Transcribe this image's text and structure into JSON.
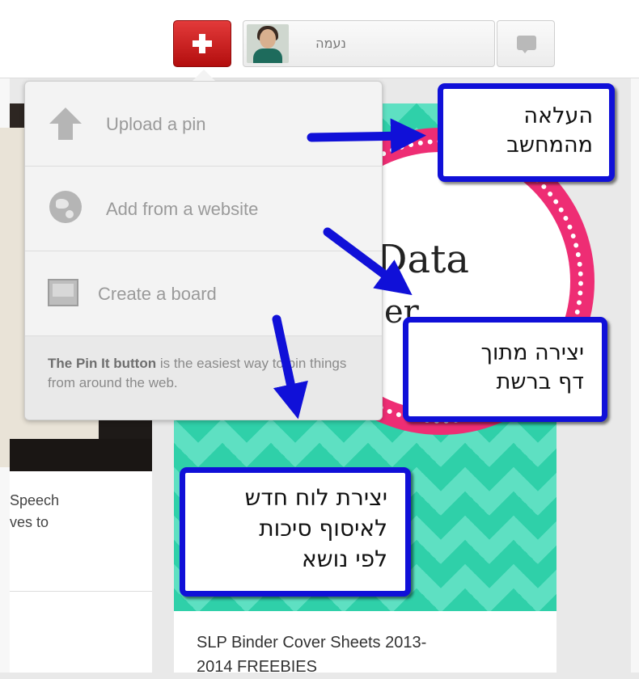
{
  "header": {
    "add_button_label": "+",
    "user_name": "נעמה"
  },
  "menu": {
    "items": [
      {
        "label": "Upload a pin",
        "icon": "upload-arrow-icon"
      },
      {
        "label": "Add from a website",
        "icon": "globe-icon"
      },
      {
        "label": "Create a board",
        "icon": "board-icon"
      }
    ],
    "footer": {
      "bold": "The Pin It button",
      "rest": " is the easiest way to pin things from around the web."
    }
  },
  "feed": {
    "left_card": {
      "description": "Speech\nves to"
    },
    "right_card": {
      "image_title": "Data",
      "image_subtitle": "er",
      "caption": "SLP Binder Cover Sheets 2013-\n2014 FREEBIES"
    }
  },
  "callouts": {
    "upload": [
      "העלאה",
      "מהמחשב"
    ],
    "website": [
      "יצירה מתוך",
      "דף ברשת"
    ],
    "board": [
      "יצירת לוח חדש",
      "לאיסוף סיכות",
      "לפי נושא"
    ]
  },
  "colors": {
    "add_button": "#cc1f1f",
    "callout_border": "#1010d8",
    "arrow": "#1010d8",
    "chevron_teal": "#2fd0a9",
    "badge_pink": "#ee2d74"
  }
}
